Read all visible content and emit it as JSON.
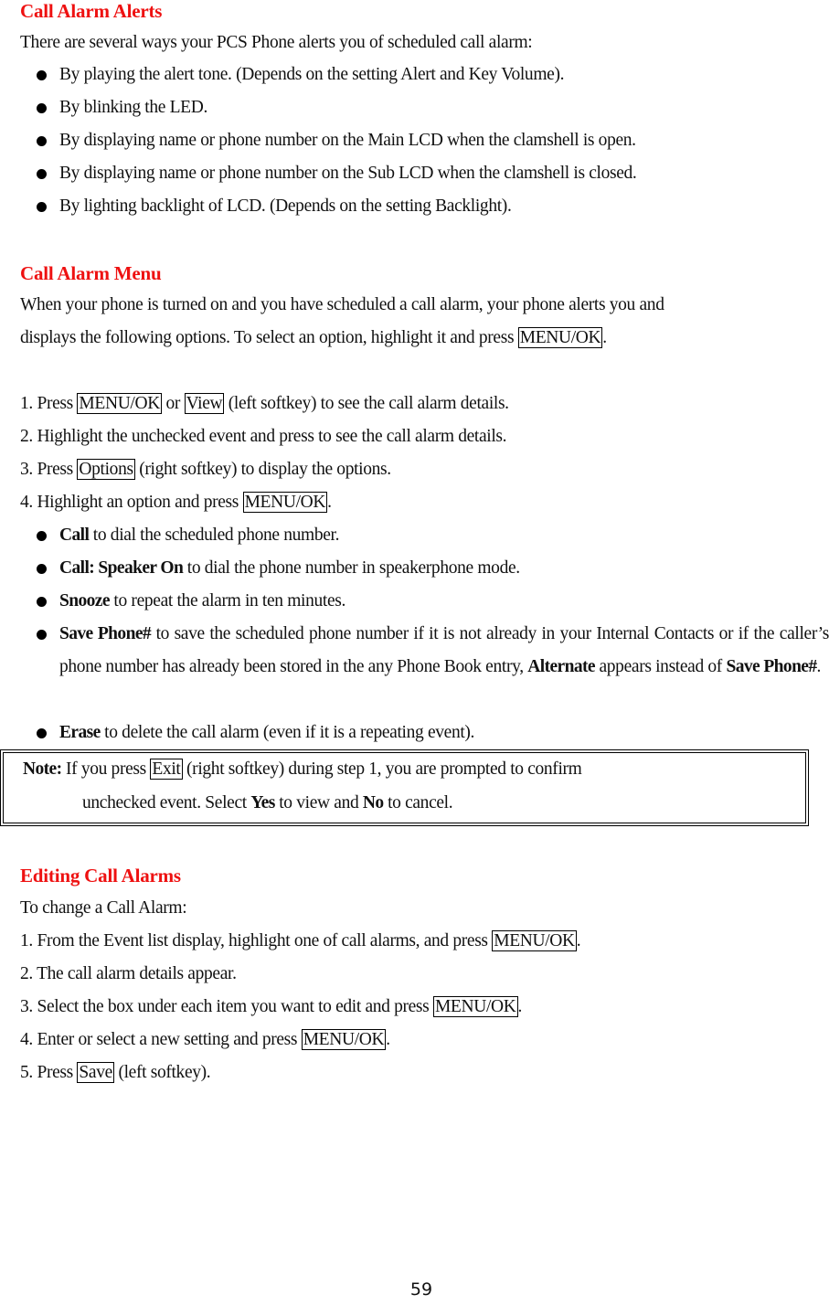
{
  "sections": {
    "alerts": {
      "title": "Call Alarm Alerts",
      "intro": "There are several ways your PCS Phone alerts you of scheduled call alarm:",
      "bullets": [
        "By playing the alert tone. (Depends on the setting Alert and Key Volume).",
        "By blinking the LED.",
        "By displaying name or phone number on the Main LCD when the clamshell is open.",
        "By displaying name or phone number on the Sub LCD when the clamshell is closed.",
        "By lighting backlight of LCD. (Depends on the setting Backlight)."
      ]
    },
    "menu": {
      "title": "Call Alarm Menu",
      "intro_line1": "When your phone is turned on and you have scheduled a call alarm, your phone alerts you and",
      "intro_line2_pre": "displays the following options. To select an option, highlight it and press ",
      "intro_line2_key": "MENU/OK",
      "intro_line2_post": ".",
      "steps": {
        "s1_pre": "1. Press ",
        "s1_key1": "MENU/OK",
        "s1_mid": " or ",
        "s1_key2": "View",
        "s1_post": " (left softkey) to see the call alarm details.",
        "s2": "2. Highlight the unchecked event and press to see the call alarm details.",
        "s3_pre": "3. Press ",
        "s3_key": "Options",
        "s3_post": " (right softkey) to display the options.",
        "s4_pre": "4. Highlight an option and press ",
        "s4_key": "MENU/OK",
        "s4_post": "."
      },
      "options": {
        "call_term": "Call",
        "call_desc": " to dial the scheduled phone number.",
        "speaker_term": "Call: Speaker On",
        "speaker_desc": " to dial the phone number in speakerphone mode.",
        "snooze_term": "Snooze",
        "snooze_desc": " to repeat the alarm in ten minutes.",
        "save_term": "Save Phone#",
        "save_desc_a": " to save the scheduled phone number if it is not already in your Internal Contacts or if the caller’s phone number has already been stored in the any Phone Book entry, ",
        "save_alt_term": "Alternate",
        "save_desc_b": " appears instead of ",
        "save_term2": "Save Phone#",
        "save_desc_c": ".",
        "erase_term": "Erase",
        "erase_desc": " to delete the call alarm (even if it is a repeating event)."
      },
      "note": {
        "label": "Note:",
        "line1_pre": " If you press ",
        "line1_key": "Exit",
        "line1_post": " (right softkey) during step 1, you are prompted to confirm",
        "line2_pre": "unchecked event. Select ",
        "line2_yes": "Yes",
        "line2_mid": " to view and ",
        "line2_no": "No",
        "line2_post": " to cancel."
      }
    },
    "editing": {
      "title": "Editing Call Alarms",
      "intro": "To change a Call Alarm:",
      "s1_pre": "1. From the Event list display, highlight one of call alarms, and press ",
      "s1_key": "MENU/OK",
      "s1_post": ".",
      "s2": "2. The call alarm details appear.",
      "s3_pre": "3. Select the box under each item you want to edit and press ",
      "s3_key": "MENU/OK",
      "s3_post": ".",
      "s4_pre": "4. Enter or select a new setting and press ",
      "s4_key": "MENU/OK",
      "s4_post": ".",
      "s5_pre": "5. Press ",
      "s5_key": "Save",
      "s5_post": " (left softkey)."
    }
  },
  "footer": {
    "page_number": "59"
  },
  "colors": {
    "heading": "#ee1111",
    "text": "#111111"
  }
}
